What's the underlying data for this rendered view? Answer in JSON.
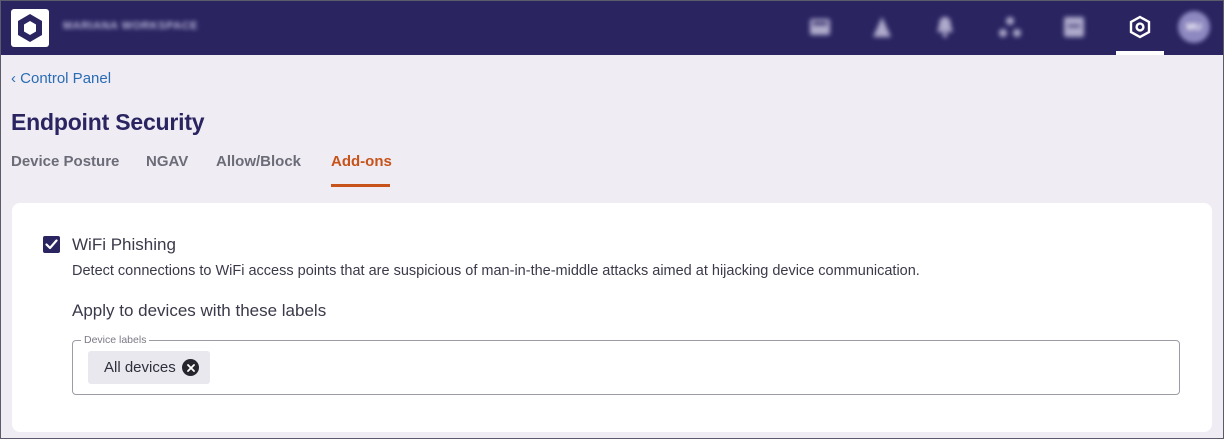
{
  "header": {
    "workspace_name": "MARIANA WORKSPACE",
    "avatar_initials": "MU",
    "nav_icons": [
      "reports-icon",
      "alerts-icon",
      "notifications-icon",
      "network-icon",
      "grid-icon",
      "settings-icon"
    ],
    "active_nav": "settings-icon"
  },
  "breadcrumb": {
    "label": "‹ Control Panel"
  },
  "page": {
    "title": "Endpoint Security"
  },
  "tabs": [
    {
      "label": "Device Posture"
    },
    {
      "label": "NGAV"
    },
    {
      "label": "Allow/Block"
    },
    {
      "label": "Add-ons",
      "active": true
    }
  ],
  "addon": {
    "checked": true,
    "title": "WiFi Phishing",
    "description": "Detect connections to WiFi access points that are suspicious of man-in-the-middle attacks aimed at hijacking device communication.",
    "apply_label": "Apply to devices with these labels",
    "field": {
      "legend": "Device labels",
      "chips": [
        {
          "label": "All devices"
        }
      ]
    }
  },
  "colors": {
    "header_bg": "#2a2461",
    "accent": "#c7521a",
    "link": "#2a6cb5",
    "title": "#2a2461"
  }
}
